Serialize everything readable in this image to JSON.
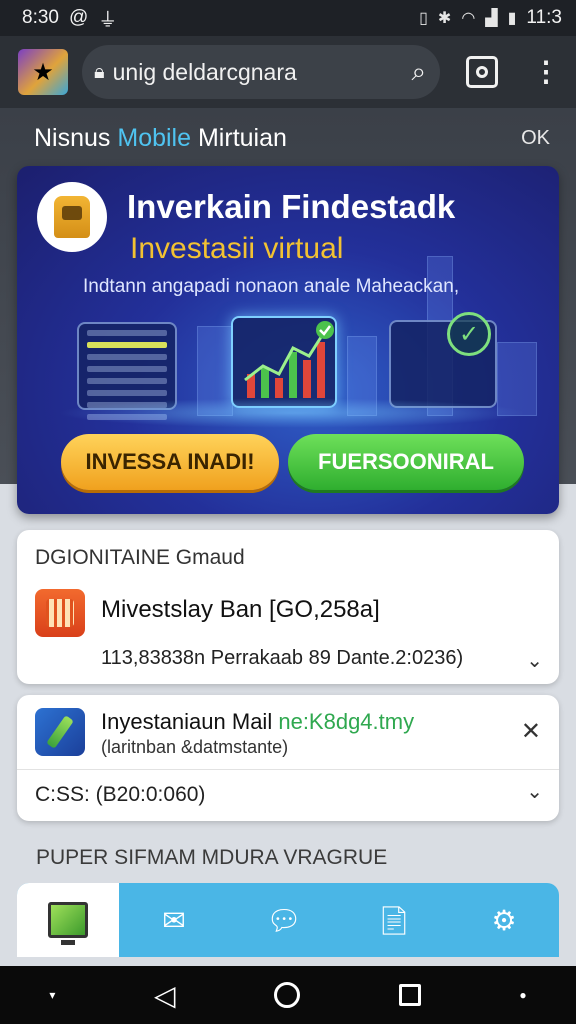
{
  "status_bar": {
    "time": "8:30",
    "at_icon": "@",
    "battery_text": "11:3"
  },
  "browser": {
    "url": "unig deldarcgnara"
  },
  "header": {
    "title_prefix": "Nisnus",
    "title_accent": "Mobile",
    "title_suffix": "Mirtuian",
    "close_label": "OK"
  },
  "hero": {
    "title": "Inverkain Findestadk",
    "subtitle": "Investasii virtual",
    "tagline": "Indtann angapadi nonaon anale Maheackan,",
    "invest_button": "INVESSA INADI!",
    "register_button": "FUERSOONIRAL"
  },
  "account_card": {
    "heading": "DGIONITAINE Gmaud",
    "title": "Mivestslay Ban [GO,258a]",
    "detail": "113,83838n Perrakaab 89 Dante.2:0236)"
  },
  "mail_card": {
    "title": "Inyestaniaun Mail",
    "title_green": "ne:K8dg4.tmy",
    "subtitle": "(laritnban &datmstante)",
    "css_line": "C:SS: (B20:0:060)"
  },
  "section_label": "PUPER SIFMAM MDURA VRAGRUE",
  "icons": {
    "status": [
      "at-icon",
      "usb-icon",
      "vibrate-icon",
      "bluetooth-icon",
      "wifi-icon",
      "signal-icon",
      "battery-icon"
    ],
    "bottom_nav": [
      "monitor-icon",
      "mail-icon",
      "chat-icon",
      "document-icon",
      "settings-icon"
    ]
  },
  "colors": {
    "accent": "#4fc3f0",
    "hero_bg": "#23309a",
    "invest_btn": "#f0a11e",
    "register_btn": "#2fae2f",
    "nav_bg": "#4ab6e6"
  }
}
